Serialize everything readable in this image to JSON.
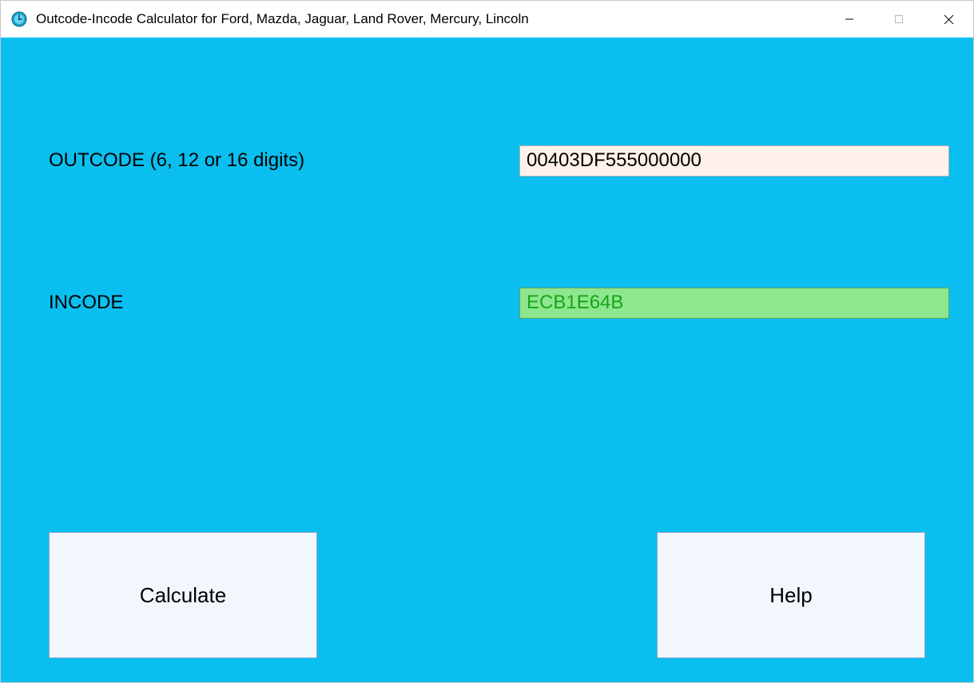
{
  "window": {
    "title": "Outcode-Incode Calculator for Ford, Mazda, Jaguar, Land Rover, Mercury, Lincoln"
  },
  "fields": {
    "outcode": {
      "label": "OUTCODE (6, 12 or 16 digits)",
      "value": "00403DF555000000"
    },
    "incode": {
      "label": "INCODE",
      "value": "ECB1E64B"
    }
  },
  "buttons": {
    "calculate": "Calculate",
    "help": "Help"
  }
}
